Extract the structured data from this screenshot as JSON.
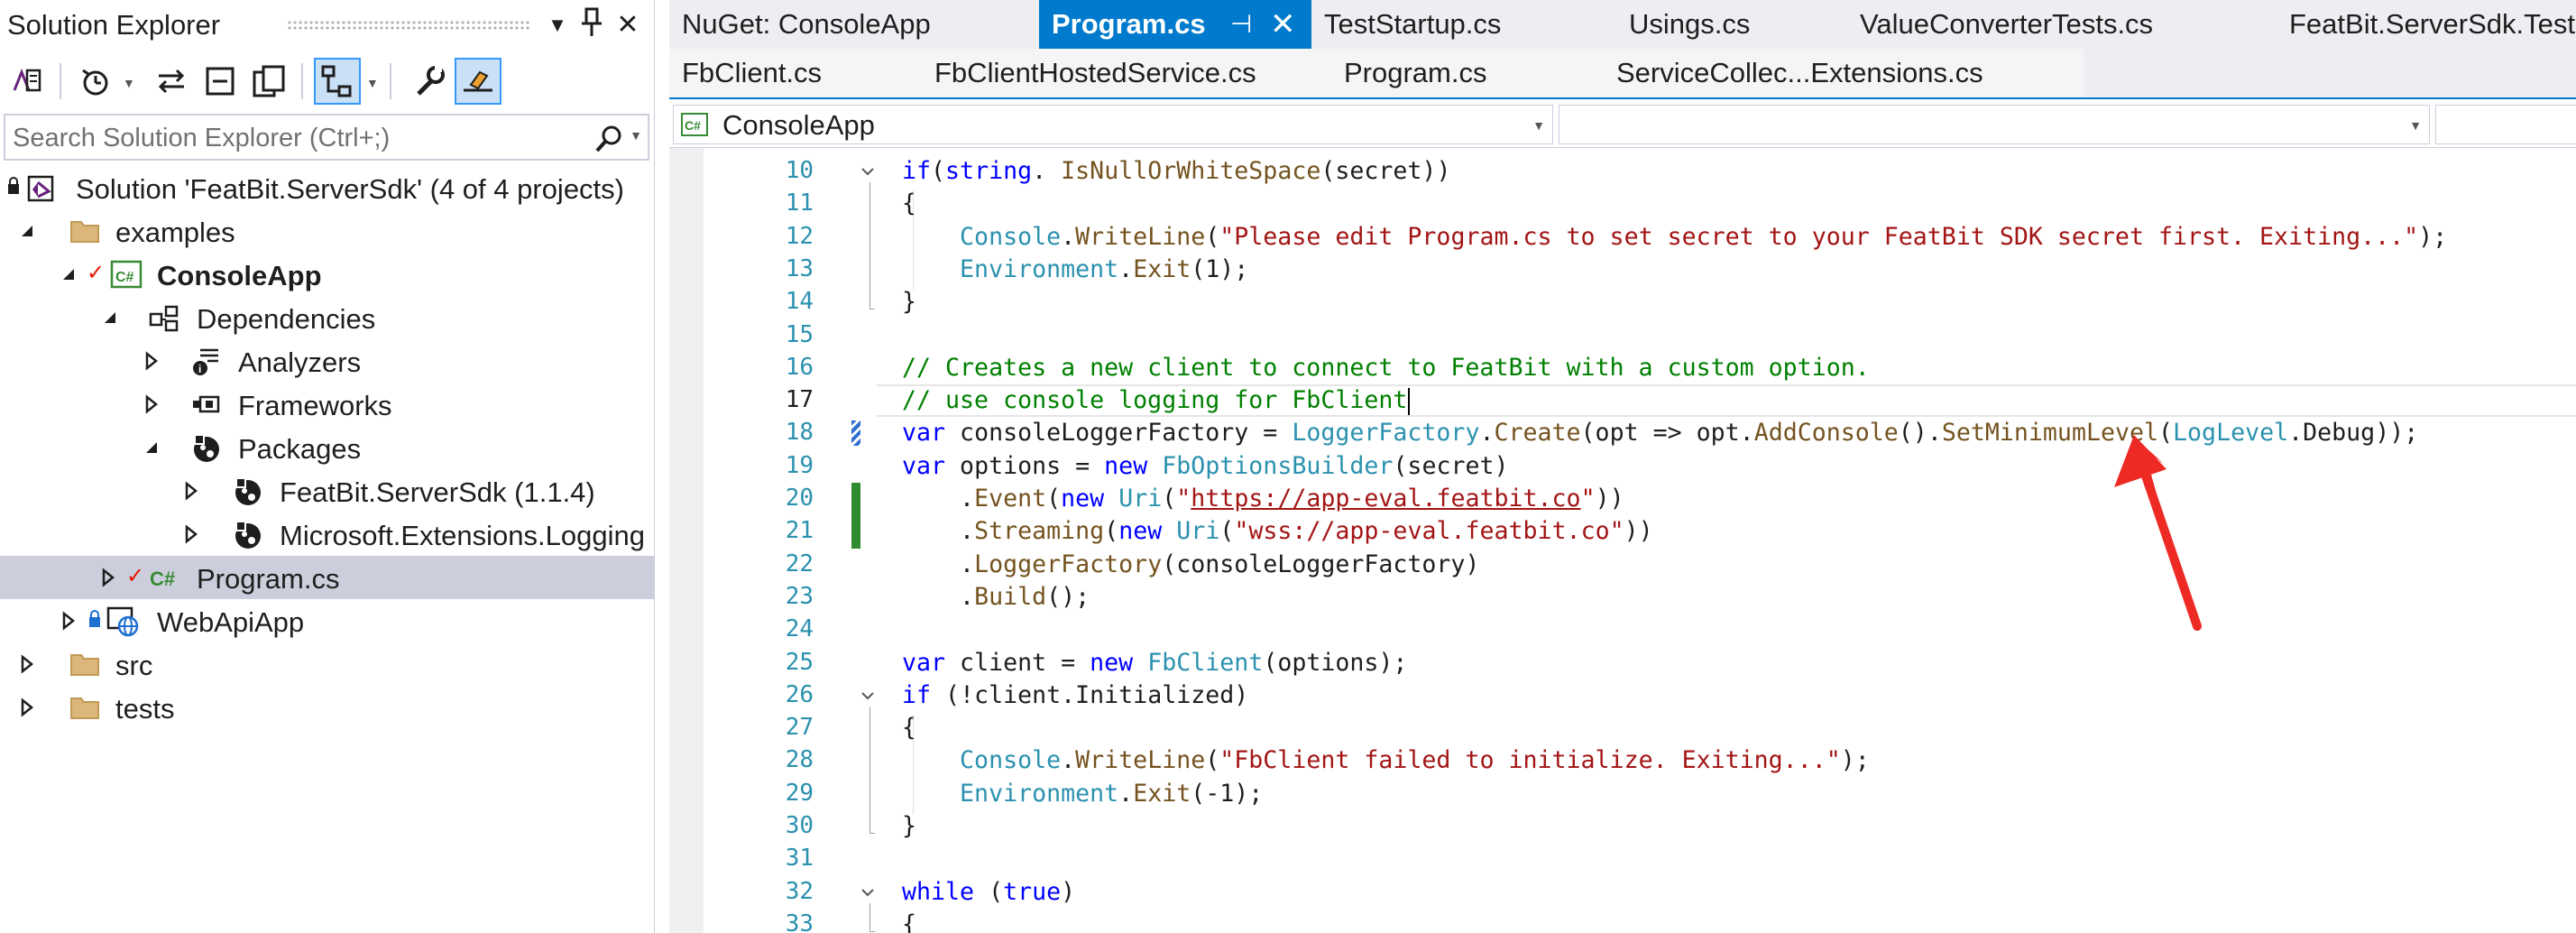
{
  "solution_explorer": {
    "title": "Solution Explorer",
    "search_placeholder": "Search Solution Explorer (Ctrl+;)",
    "tree": [
      {
        "label": "Solution 'FeatBit.ServerSdk' (4 of 4 projects)",
        "icon": "solution-icon"
      },
      {
        "label": "examples",
        "icon": "folder-icon"
      },
      {
        "label": "ConsoleApp",
        "icon": "csharp-project-icon"
      },
      {
        "label": "Dependencies",
        "icon": "dependencies-icon"
      },
      {
        "label": "Analyzers",
        "icon": "analyzer-icon"
      },
      {
        "label": "Frameworks",
        "icon": "framework-icon"
      },
      {
        "label": "Packages",
        "icon": "package-icon"
      },
      {
        "label": "FeatBit.ServerSdk (1.1.4)",
        "icon": "package-icon"
      },
      {
        "label": "Microsoft.Extensions.Logging",
        "icon": "package-icon"
      },
      {
        "label": "Program.cs",
        "icon": "csharp-file-icon"
      },
      {
        "label": "WebApiApp",
        "icon": "web-project-icon"
      },
      {
        "label": "src",
        "icon": "folder-icon"
      },
      {
        "label": "tests",
        "icon": "folder-icon"
      }
    ]
  },
  "tabs": {
    "row1": [
      "NuGet: ConsoleApp",
      "Program.cs",
      "TestStartup.cs",
      "Usings.cs",
      "ValueConverterTests.cs",
      "FeatBit.ServerSdk.Tests"
    ],
    "row2": [
      "FbClient.cs",
      "FbClientHostedService.cs",
      "Program.cs",
      "ServiceCollec...Extensions.cs"
    ],
    "active": "Program.cs"
  },
  "navbar": {
    "project": "ConsoleApp",
    "member": ""
  },
  "editor": {
    "current_line": 17,
    "lines": [
      {
        "n": "10",
        "tokens": [
          [
            "k",
            "if"
          ],
          [
            "",
            "("
          ],
          [
            "k",
            "string"
          ],
          [
            "",
            ". "
          ],
          [
            "m",
            "IsNullOrWhiteSpace"
          ],
          [
            "",
            "(secret))"
          ]
        ]
      },
      {
        "n": "11",
        "tokens": [
          [
            "",
            "{"
          ]
        ]
      },
      {
        "n": "12",
        "tokens": [
          [
            "",
            "    "
          ],
          [
            "t",
            "Console"
          ],
          [
            "",
            "."
          ],
          [
            "m",
            "WriteLine"
          ],
          [
            "",
            "("
          ],
          [
            "s",
            "\"Please edit Program.cs to set secret to your FeatBit SDK secret first. Exiting...\""
          ],
          [
            "",
            ");"
          ]
        ]
      },
      {
        "n": "13",
        "tokens": [
          [
            "",
            "    "
          ],
          [
            "t",
            "Environment"
          ],
          [
            "",
            "."
          ],
          [
            "m",
            "Exit"
          ],
          [
            "",
            "(1);"
          ]
        ]
      },
      {
        "n": "14",
        "tokens": [
          [
            "",
            "}"
          ]
        ]
      },
      {
        "n": "15",
        "tokens": []
      },
      {
        "n": "16",
        "tokens": [
          [
            "c",
            "// Creates a new client to connect to FeatBit with a custom option."
          ]
        ]
      },
      {
        "n": "17",
        "tokens": [
          [
            "c",
            "// use console logging for FbClient"
          ]
        ]
      },
      {
        "n": "18",
        "tokens": [
          [
            "k",
            "var"
          ],
          [
            "",
            " consoleLoggerFactory = "
          ],
          [
            "t",
            "LoggerFactory"
          ],
          [
            "",
            "."
          ],
          [
            "m",
            "Create"
          ],
          [
            "",
            "(opt => opt."
          ],
          [
            "m",
            "AddConsole"
          ],
          [
            "",
            "()."
          ],
          [
            "m",
            "SetMinimumLevel"
          ],
          [
            "",
            "("
          ],
          [
            "t",
            "LogLevel"
          ],
          [
            "",
            ".Debug));"
          ]
        ]
      },
      {
        "n": "19",
        "tokens": [
          [
            "k",
            "var"
          ],
          [
            "",
            " options = "
          ],
          [
            "k",
            "new"
          ],
          [
            "",
            "",
            " "
          ],
          [
            "t",
            "FbOptionsBuilder"
          ],
          [
            "",
            "(secret)"
          ]
        ]
      },
      {
        "n": "20",
        "tokens": [
          [
            "",
            "    ."
          ],
          [
            "m",
            "Event"
          ],
          [
            "",
            "("
          ],
          [
            "k",
            "new"
          ],
          [
            "",
            " "
          ],
          [
            "t",
            "Uri"
          ],
          [
            "",
            "("
          ],
          [
            "s",
            "\""
          ],
          [
            "su",
            "https://app-eval.featbit.co"
          ],
          [
            "s",
            "\""
          ],
          [
            "",
            "))"
          ]
        ]
      },
      {
        "n": "21",
        "tokens": [
          [
            "",
            "    ."
          ],
          [
            "m",
            "Streaming"
          ],
          [
            "",
            "("
          ],
          [
            "k",
            "new"
          ],
          [
            "",
            " "
          ],
          [
            "t",
            "Uri"
          ],
          [
            "",
            "("
          ],
          [
            "s",
            "\"wss://app-eval.featbit.co\""
          ],
          [
            "",
            "))"
          ]
        ]
      },
      {
        "n": "22",
        "tokens": [
          [
            "",
            "    ."
          ],
          [
            "m",
            "LoggerFactory"
          ],
          [
            "",
            "(consoleLoggerFactory)"
          ]
        ]
      },
      {
        "n": "23",
        "tokens": [
          [
            "",
            "    ."
          ],
          [
            "m",
            "Build"
          ],
          [
            "",
            "();"
          ]
        ]
      },
      {
        "n": "24",
        "tokens": []
      },
      {
        "n": "25",
        "tokens": [
          [
            "k",
            "var"
          ],
          [
            "",
            " client = "
          ],
          [
            "k",
            "new"
          ],
          [
            "",
            " "
          ],
          [
            "t",
            "FbClient"
          ],
          [
            "",
            "(options);"
          ]
        ]
      },
      {
        "n": "26",
        "tokens": [
          [
            "k",
            "if"
          ],
          [
            "",
            " (!client.Initialized)"
          ]
        ]
      },
      {
        "n": "27",
        "tokens": [
          [
            "",
            "{"
          ]
        ]
      },
      {
        "n": "28",
        "tokens": [
          [
            "",
            "    "
          ],
          [
            "t",
            "Console"
          ],
          [
            "",
            "."
          ],
          [
            "m",
            "WriteLine"
          ],
          [
            "",
            "("
          ],
          [
            "s",
            "\"FbClient failed to initialize. Exiting...\""
          ],
          [
            "",
            ");"
          ]
        ]
      },
      {
        "n": "29",
        "tokens": [
          [
            "",
            "    "
          ],
          [
            "t",
            "Environment"
          ],
          [
            "",
            "."
          ],
          [
            "m",
            "Exit"
          ],
          [
            "",
            "(-1);"
          ]
        ]
      },
      {
        "n": "30",
        "tokens": [
          [
            "",
            "}"
          ]
        ]
      },
      {
        "n": "31",
        "tokens": []
      },
      {
        "n": "32",
        "tokens": [
          [
            "k",
            "while"
          ],
          [
            "",
            " ("
          ],
          [
            "k",
            "true"
          ],
          [
            "",
            ")"
          ]
        ]
      },
      {
        "n": "33",
        "tokens": [
          [
            "",
            "{"
          ]
        ]
      }
    ]
  },
  "colors": {
    "keyword": "#0000ff",
    "type": "#2b91af",
    "method": "#74531f",
    "string": "#a31515",
    "comment": "#008000",
    "accent": "#007acc",
    "annotation_arrow": "#ee2a24"
  }
}
